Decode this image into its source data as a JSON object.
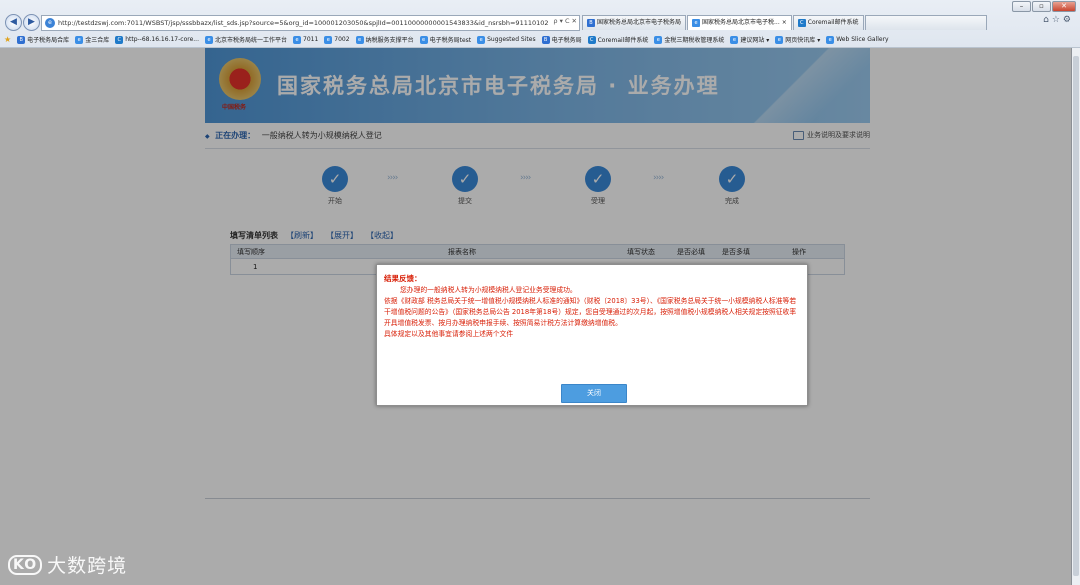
{
  "browser": {
    "address": "http://testdzswj.com:7011/WSBST/jsp/sssbbazx/list_sds.jsp?source=5&org_id=100001203050&spjlId=00110000000001543833&id_nsrsbh=91110102",
    "address_tools": "ρ ▾ C ✕",
    "tabs": [
      {
        "label": "国家税务总局北京市电子税务局",
        "icon": "B",
        "icon_color": "#2f6fd1"
      },
      {
        "label": "国家税务总局北京市电子税...",
        "icon": "e",
        "icon_color": "#3a8ee6"
      },
      {
        "label": "Coremail邮件系统",
        "icon": "C",
        "icon_color": "#1f7ac9"
      }
    ],
    "tab_close": "×",
    "favorites": [
      {
        "label": "电子税务局合库",
        "icon": "B",
        "color": "#2f6fd1"
      },
      {
        "label": "金三合库",
        "icon": "e",
        "color": "#3a8ee6"
      },
      {
        "label": "http--68.16.16.17-core...",
        "icon": "C",
        "color": "#1f7ac9"
      },
      {
        "label": "北京市税务局统一工作平台",
        "icon": "e",
        "color": "#3a8ee6"
      },
      {
        "label": "7011",
        "icon": "e",
        "color": "#3a8ee6"
      },
      {
        "label": "7002",
        "icon": "e",
        "color": "#3a8ee6"
      },
      {
        "label": "纳税服务支撑平台",
        "icon": "e",
        "color": "#3a8ee6"
      },
      {
        "label": "电子税务局test",
        "icon": "e",
        "color": "#3a8ee6"
      },
      {
        "label": "Suggested Sites",
        "icon": "e",
        "color": "#3a8ee6"
      },
      {
        "label": "电子税务局",
        "icon": "B",
        "color": "#2f6fd1"
      },
      {
        "label": "Coremail邮件系统",
        "icon": "C",
        "color": "#1f7ac9"
      },
      {
        "label": "金税三期税收管理系统",
        "icon": "e",
        "color": "#3a8ee6"
      },
      {
        "label": "建议网站 ▾",
        "icon": "e",
        "color": "#3a8ee6"
      },
      {
        "label": "网页快讯库 ▾",
        "icon": "e",
        "color": "#3a8ee6"
      },
      {
        "label": "Web Slice Gallery",
        "icon": "e",
        "color": "#3a8ee6"
      }
    ]
  },
  "site": {
    "banner_title": "国家税务总局北京市电子税务局 · 业务办理",
    "emblem_text": "中国税务",
    "crumb_label": "正在办理：",
    "crumb_desc": "一般纳税人转为小规模纳税人登记",
    "help_label": "业务说明及要求说明",
    "steps": [
      {
        "label": "开始"
      },
      {
        "label": "提交"
      },
      {
        "label": "受理"
      },
      {
        "label": "完成"
      }
    ],
    "list_title": "填写清单列表",
    "list_links": [
      "【刷新】",
      "【展开】",
      "【收起】"
    ],
    "table_headers": [
      "填写顺序",
      "报表名称",
      "填写状态",
      "是否必填",
      "是否多填",
      "操作"
    ],
    "table_rows": [
      [
        "1",
        "",
        "",
        "",
        "",
        ""
      ]
    ]
  },
  "modal": {
    "title": "结果反馈：",
    "line1": "您办理的一般纳税人转为小规模纳税人登记业务受理成功。",
    "line2": "依据《财政部 税务总局关于统一增值税小规模纳税人标准的通知》（财税〔2018〕33号）、《国家税务总局关于统一小规模纳税人标准等若干增值税问题的公告》（国家税务总局公告 2018年第18号）规定，您自受理通过的次月起，按照增值税小规模纳税人相关规定按照征收率开具增值税发票、按月办理纳税申报手续、按照简易计税方法计算缴纳增值税。",
    "line3": "具体规定以及其他事宜请参阅上述两个文件",
    "close_button": "关闭"
  },
  "watermark": {
    "logo": "KO",
    "text": "大数跨境"
  },
  "colors": {
    "modal_text": "#d81e06",
    "primary_blue": "#3a89d9",
    "button_blue": "#4d9de0"
  }
}
